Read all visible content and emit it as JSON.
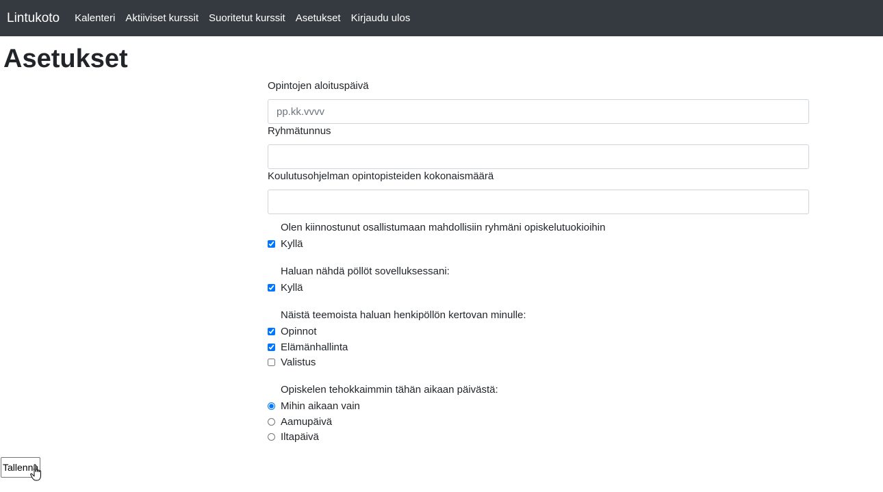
{
  "navbar": {
    "brand": "Lintukoto",
    "links": [
      "Kalenteri",
      "Aktiiviset kurssit",
      "Suoritetut kurssit",
      "Asetukset",
      "Kirjaudu ulos"
    ]
  },
  "page": {
    "title": "Asetukset"
  },
  "form": {
    "start_date": {
      "label": "Opintojen aloituspäivä",
      "placeholder": "pp.kk.vvvv",
      "value": ""
    },
    "group_code": {
      "label": "Ryhmätunnus",
      "value": ""
    },
    "total_credits": {
      "label": "Koulutusohjelman opintopisteiden kokonaismäärä",
      "value": ""
    },
    "study_groups": {
      "label": "Olen kiinnostunut osallistumaan mahdollisiin ryhmäni opiskelutuokioihin",
      "options": [
        {
          "label": "Kyllä",
          "checked": true
        }
      ]
    },
    "show_owls": {
      "label": "Haluan nähdä pöllöt sovelluksessani:",
      "options": [
        {
          "label": "Kyllä",
          "checked": true
        }
      ]
    },
    "topics": {
      "label": "Näistä teemoista haluan henkipöllön kertovan minulle:",
      "options": [
        {
          "label": "Opinnot",
          "checked": true
        },
        {
          "label": "Elämänhallinta",
          "checked": true
        },
        {
          "label": "Valistus",
          "checked": false
        }
      ]
    },
    "study_time": {
      "label": "Opiskelen tehokkaimmin tähän aikaan päivästä:",
      "options": [
        {
          "label": "Mihin aikaan vain",
          "checked": true
        },
        {
          "label": "Aamupäivä",
          "checked": false
        },
        {
          "label": "Iltapäivä",
          "checked": false
        }
      ]
    },
    "save_label": "Tallenna"
  },
  "icons": {
    "cursor": "hand-pointer-cursor-icon"
  },
  "colors": {
    "navbar_bg": "#343a40",
    "navbar_text": "#ffffff",
    "input_border": "#ced4da"
  }
}
